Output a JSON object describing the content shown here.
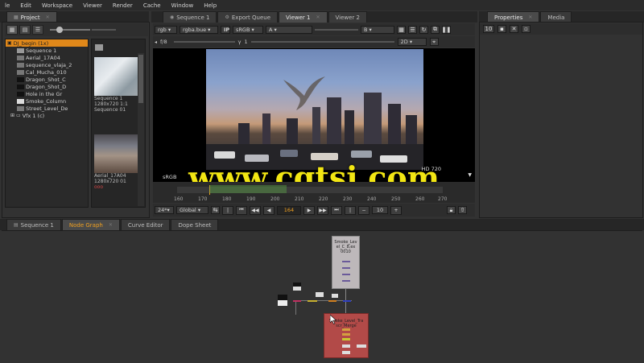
{
  "menu": [
    "le",
    "Edit",
    "Workspace",
    "Viewer",
    "Render",
    "Cache",
    "Window",
    "Help"
  ],
  "top_tabs": {
    "left": [
      {
        "label": "Project",
        "icon": "project-icon"
      }
    ],
    "center": [
      {
        "label": "Sequence 1"
      },
      {
        "label": "Export Queue"
      },
      {
        "label": "Viewer 1",
        "active": true
      },
      {
        "label": "Viewer 2"
      }
    ],
    "right": [
      {
        "label": "Properties"
      },
      {
        "label": "Media"
      }
    ]
  },
  "project": {
    "tree": [
      {
        "label": "DJ_begin (1x)",
        "selected": true,
        "type": "project"
      },
      {
        "label": "Sequence 1",
        "type": "seq"
      },
      {
        "label": "Aerial_17A04",
        "type": "clip"
      },
      {
        "label": "sequence_vlaja_2",
        "type": "clip"
      },
      {
        "label": "Cal_Mucha_010",
        "type": "clip"
      },
      {
        "label": "Dragon_Shot_C",
        "type": "dark"
      },
      {
        "label": "Dragon_Shot_D",
        "type": "dark"
      },
      {
        "label": "Hole in the Gr",
        "type": "dark"
      },
      {
        "label": "Smoke_Column",
        "type": "clip"
      },
      {
        "label": "Street_Level_De",
        "type": "clip"
      },
      {
        "label": "Vfx 1 (c)",
        "type": "folder"
      }
    ],
    "thumbs": [
      {
        "lines": [
          "Sequence 1",
          "1280x720 1:1",
          "Sequence  01"
        ]
      },
      {
        "lines": [
          "Aerial_17A04",
          "1280x720  01",
          "ooo"
        ]
      }
    ]
  },
  "viewer": {
    "channels": "rgb",
    "colorspace": "rgba.bue",
    "ip_label": "IP",
    "gamma": "sRGB",
    "alpha_label": "A",
    "b_label": "B",
    "view_mode": "2D",
    "fstop_label": "f/8",
    "gain_value": "1",
    "format_label": "HD 720",
    "fmt_bottom": "sRGB",
    "watermark": "www.cgtsj.com",
    "timeline_ticks": [
      "160",
      "170",
      "180",
      "190",
      "200",
      "210",
      "220",
      "230",
      "240",
      "250",
      "260",
      "270"
    ],
    "fps": "24*",
    "range": "Global",
    "current_frame": "164",
    "step": "10"
  },
  "bottom_tabs": [
    {
      "label": "Sequence 1"
    },
    {
      "label": "Node Graph",
      "active": true
    },
    {
      "label": "Curve Editor"
    },
    {
      "label": "Dope Sheet"
    }
  ],
  "nodes": {
    "read_label": [
      "Smoke_Lev",
      "el_C_8,ex",
      "0010"
    ],
    "merge_label": [
      "Smoke_Level_Tra",
      "scr_Merge"
    ]
  },
  "colors": {
    "accent": "#e0881a",
    "watermark": "#f2e613",
    "read_node": "#bdb8ba",
    "merge_node": "#b24a48"
  }
}
